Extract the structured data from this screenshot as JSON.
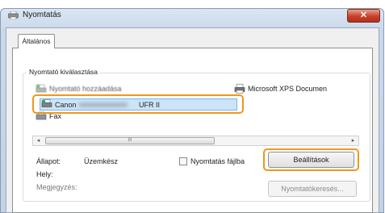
{
  "window": {
    "title": "Nyomtatás",
    "close_glyph": "✕"
  },
  "tabs": [
    {
      "label": "Általános",
      "active": true
    }
  ],
  "printer_selection": {
    "group_label": "Nyomtató kiválasztása",
    "printers": [
      {
        "label": "Nyomtató hozzáadása",
        "icon": "printer-add-icon",
        "selected": false
      },
      {
        "label": "Microsoft XPS Documen",
        "icon": "printer-icon",
        "selected": false
      },
      {
        "label": "Canon",
        "model": "UFR II",
        "icon": "printer-icon",
        "selected": true
      },
      {
        "label": "Fax",
        "icon": "fax-icon",
        "selected": false
      }
    ]
  },
  "scrollbar": {
    "left_arrow": "◂",
    "right_arrow": "▸",
    "thumb_grip": "III"
  },
  "status": {
    "label": "Állapot:",
    "value": "Üzemkész"
  },
  "location": {
    "label": "Hely:"
  },
  "comment": {
    "label": "Megjegyzés:"
  },
  "print_to_file": {
    "label": "Nyomtatás fájlba",
    "checked": false
  },
  "buttons": {
    "settings": "Beállítások",
    "find_printer": "Nyomtatókeresés..."
  },
  "colors": {
    "highlight": "#f0971a",
    "selection": "#cce4f7",
    "close_button": "#c5412a"
  }
}
